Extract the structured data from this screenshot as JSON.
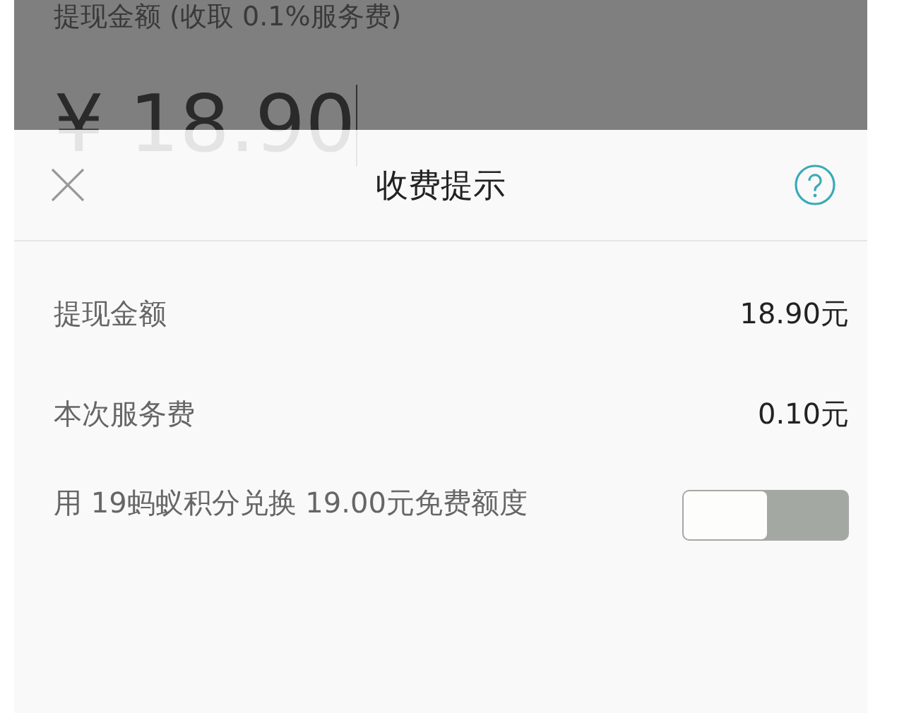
{
  "background": {
    "label": "提现金额 (收取 0.1%服务费)",
    "amount": "¥ 18.90"
  },
  "sheet": {
    "title": "收费提示",
    "rows": [
      {
        "label": "提现金额",
        "value": "18.90元"
      },
      {
        "label": "本次服务费",
        "value": "0.10元"
      }
    ],
    "option": {
      "label": "用 19蚂蚁积分兑换 19.00元免费额度",
      "on": false
    }
  }
}
